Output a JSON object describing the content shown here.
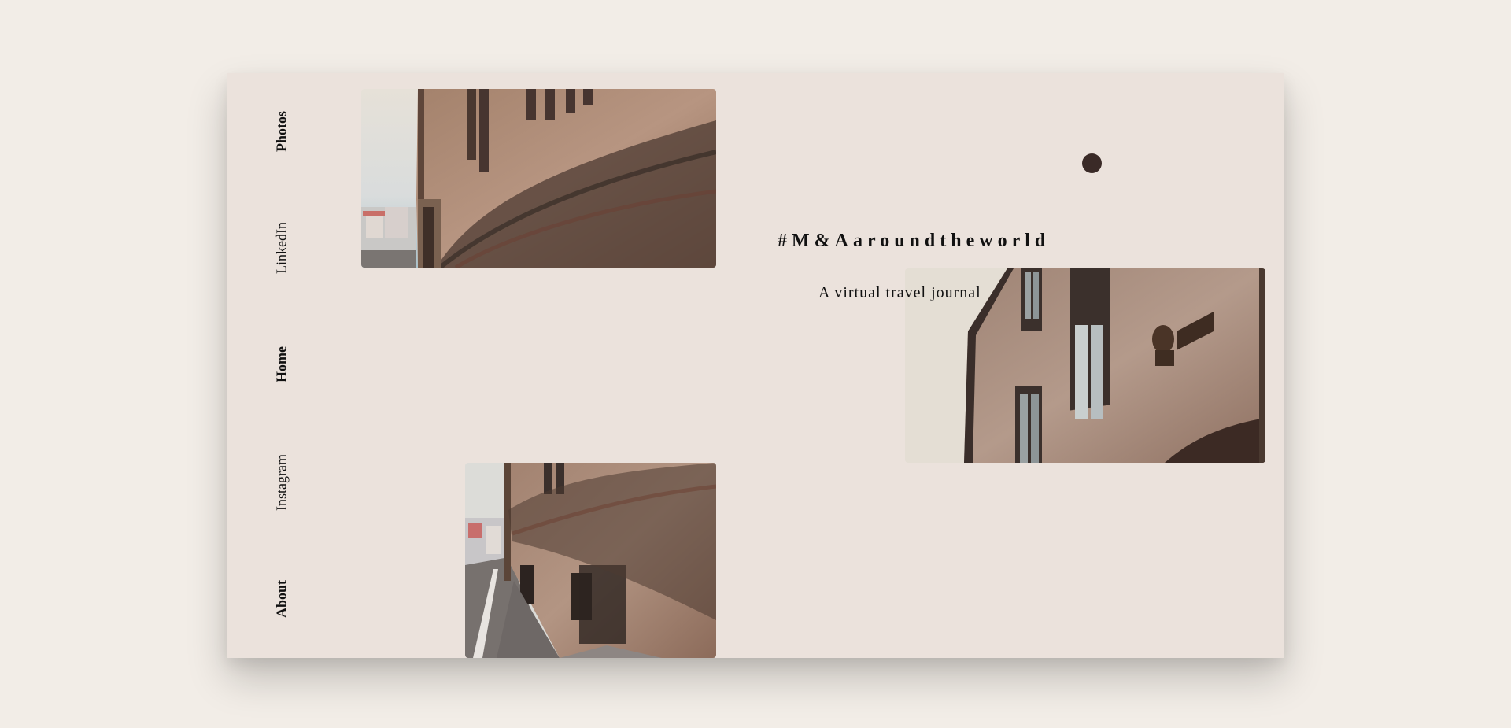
{
  "nav": {
    "items": [
      {
        "label": "Photos",
        "bold": true
      },
      {
        "label": "LinkedIn",
        "bold": false
      },
      {
        "label": "Home",
        "bold": true
      },
      {
        "label": "Instagram",
        "bold": false
      },
      {
        "label": "About",
        "bold": true
      }
    ]
  },
  "hero": {
    "hashtag": "#M&Aaroundtheworld",
    "tagline": "A virtual travel journal"
  },
  "photos": [
    {
      "name": "ivy-wall-street-photo"
    },
    {
      "name": "bust-on-building-photo"
    },
    {
      "name": "cobblestone-alley-photo"
    }
  ],
  "colors": {
    "page_background": "#f2ede7",
    "card_background": "#ebe2dc",
    "dot": "#3a2a27",
    "text": "#111111"
  }
}
